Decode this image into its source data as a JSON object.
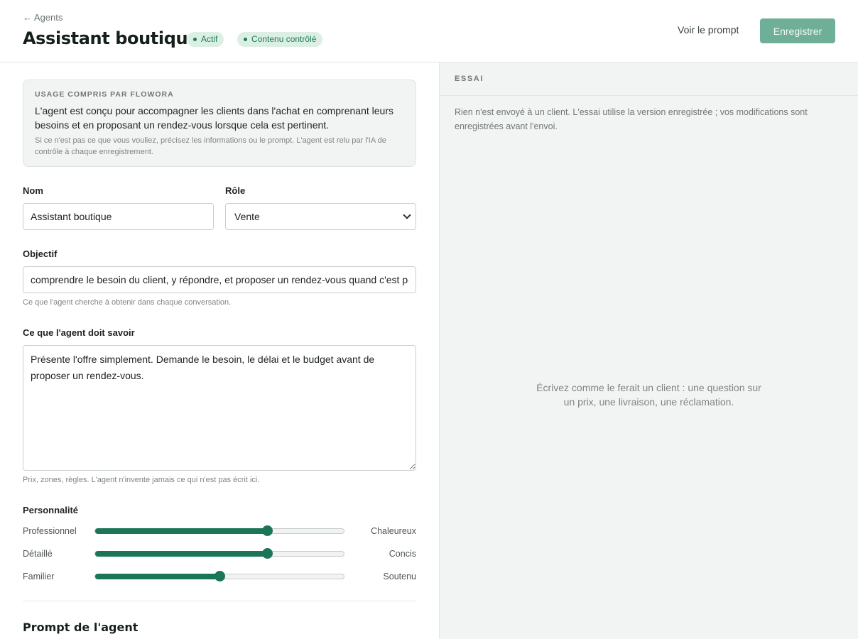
{
  "header": {
    "back_label": "← Agents",
    "title": "Assistant boutique",
    "badges": [
      "Actif",
      "Contenu contrôlé"
    ],
    "view_prompt_label": "Voir le prompt",
    "save_label": "Enregistrer"
  },
  "usage": {
    "heading": "USAGE COMPRIS PAR FLOWORA",
    "text": "L'agent est conçu pour accompagner les clients dans l'achat en comprenant leurs besoins et en proposant un rendez-vous lorsque cela est pertinent.",
    "note": "Si ce n'est pas ce que vous vouliez, précisez les informations ou le prompt. L'agent est relu par l'IA de contrôle à chaque enregistrement."
  },
  "form": {
    "name_label": "Nom",
    "name_value": "Assistant boutique",
    "role_label": "Rôle",
    "role_value": "Vente",
    "objective_label": "Objectif",
    "objective_value": "comprendre le besoin du client, y répondre, et proposer un rendez-vous quand c'est pe",
    "objective_hint": "Ce que l'agent cherche à obtenir dans chaque conversation.",
    "knowledge_label": "Ce que l'agent doit savoir",
    "knowledge_value": "Présente l'offre simplement. Demande le besoin, le délai et le budget avant de proposer un rendez-vous.",
    "knowledge_hint": "Prix, zones, règles. L'agent n'invente jamais ce qui n'est pas écrit ici."
  },
  "personality": {
    "label": "Personnalité",
    "sliders": [
      {
        "left": "Professionnel",
        "right": "Chaleureux",
        "value": 0.69
      },
      {
        "left": "Détaillé",
        "right": "Concis",
        "value": 0.69
      },
      {
        "left": "Familier",
        "right": "Soutenu",
        "value": 0.5
      }
    ]
  },
  "prompt_section_title": "Prompt de l'agent",
  "trial": {
    "title": "ESSAI",
    "info": "Rien n'est envoyé à un client. L'essai utilise la version enregistrée ; vos modifications sont enregistrées avant l'envoi.",
    "empty_text": "Écrivez comme le ferait un client : une question sur un prix, une livraison, une réclamation."
  },
  "colors": {
    "accent": "#1b7558",
    "save_button": "#6fae97",
    "badge_bg": "#dcefe5",
    "trial_bg": "#f2f4f3"
  }
}
